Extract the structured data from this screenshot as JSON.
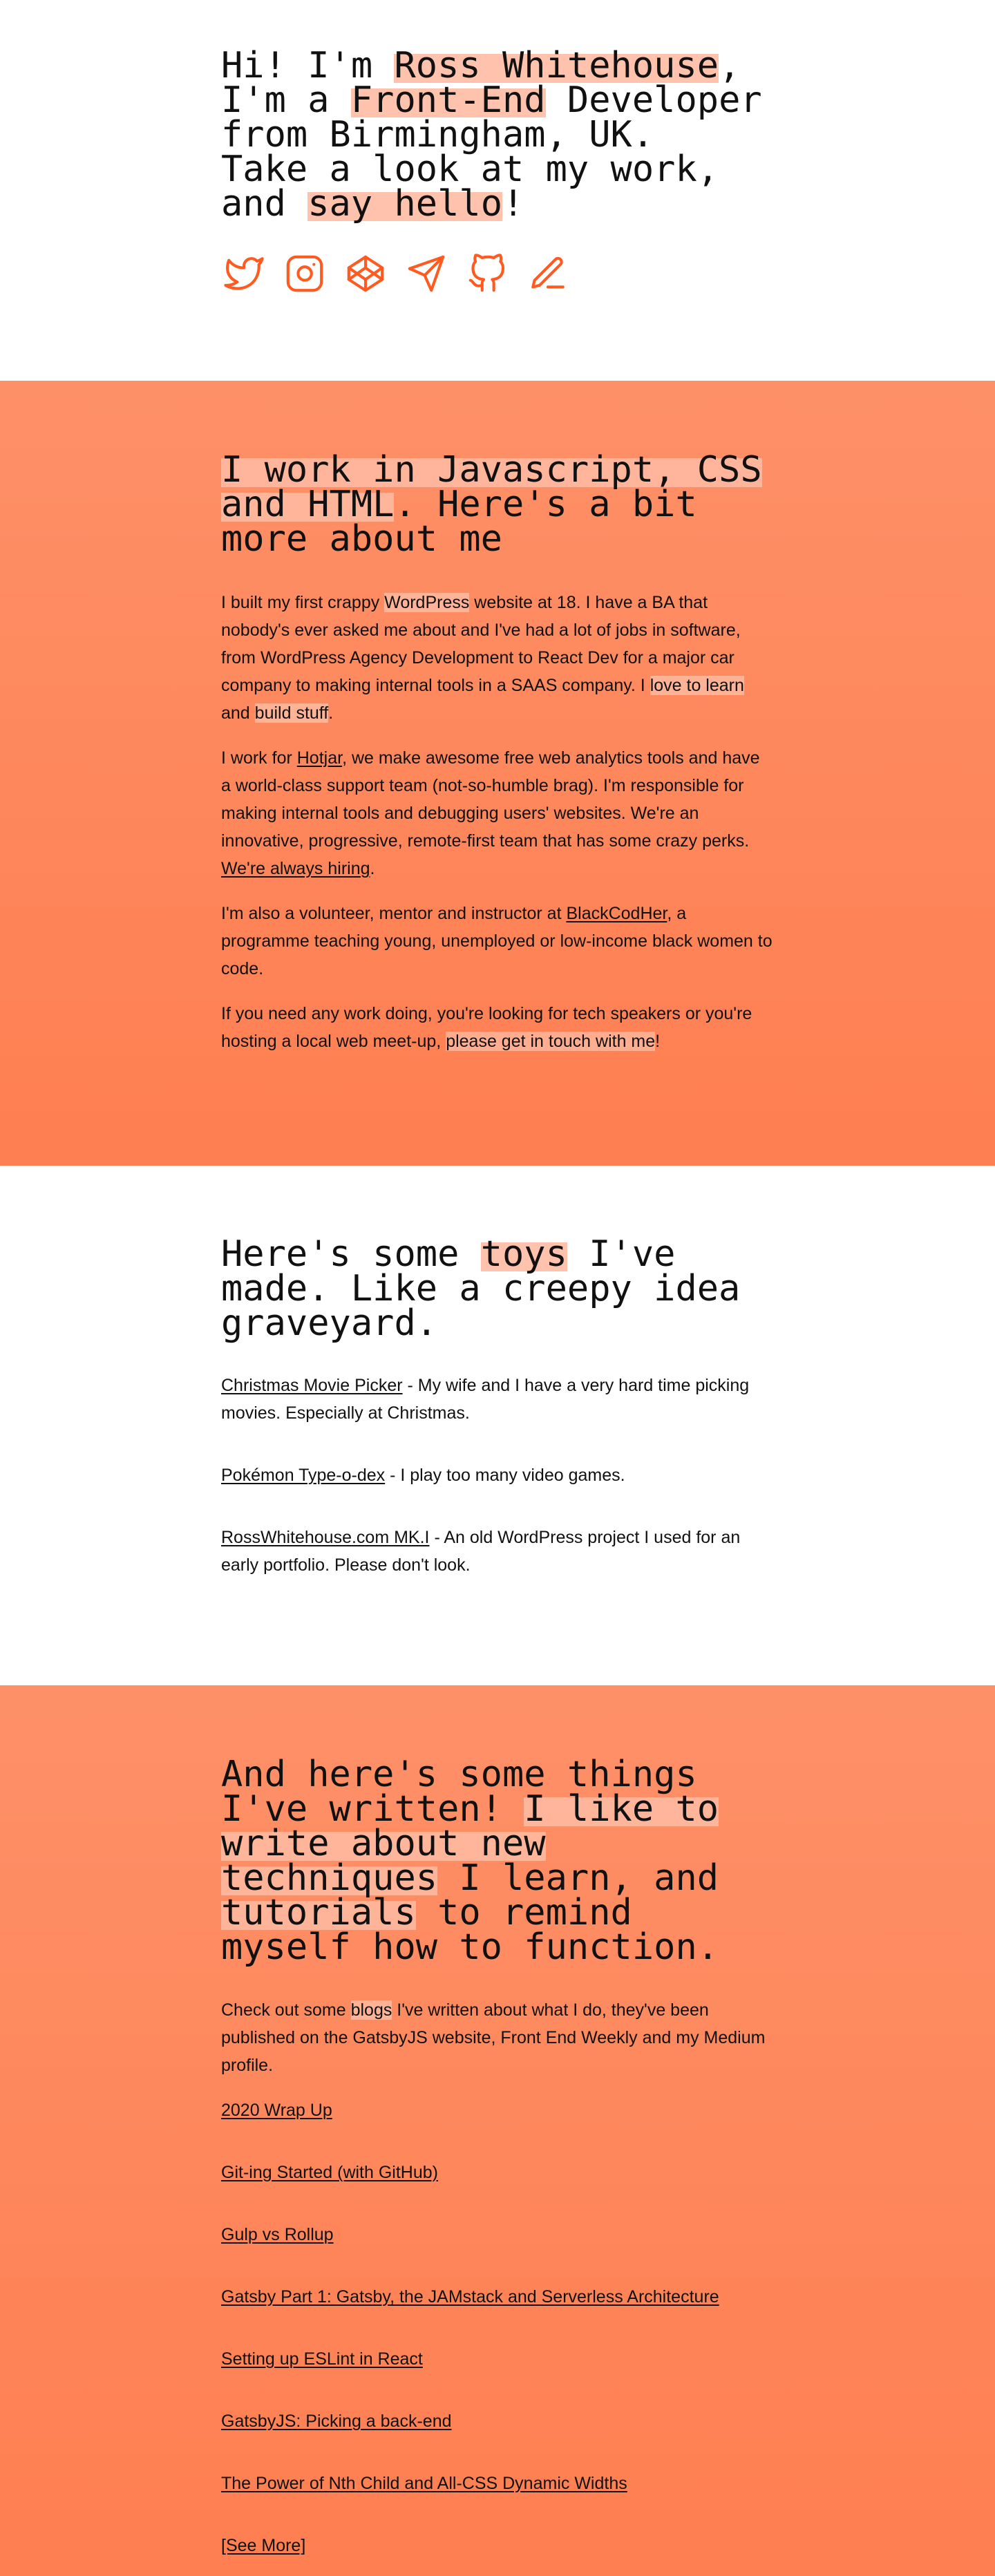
{
  "colors": {
    "accent": "#ff5a1f",
    "highlight": "#ffb79c",
    "section_gradient_top": "#fe9068",
    "section_gradient_bottom": "#fe7f51",
    "text": "#111111"
  },
  "hero": {
    "greeting_prefix": "Hi! I'm ",
    "name": "Ross Whitehouse",
    "comma": ",",
    "role_prefix": "I'm a ",
    "role": "Front-End",
    "role_suffix": " Developer",
    "location": "from Birmingham, UK.",
    "cta_line": "Take a look at my work,",
    "and": "and ",
    "say_hello": "say hello",
    "exclaim": "!",
    "social_icons": [
      "twitter-icon",
      "instagram-icon",
      "codepen-icon",
      "send-icon",
      "github-icon",
      "pen-icon"
    ]
  },
  "about": {
    "title_part1": "I work in Javascript, CSS",
    "title_part2": "and HTML",
    "title_part3": ". Here's a bit more about me",
    "p1_part1": "I built my first crappy ",
    "p1_wordpress": "WordPress",
    "p1_part2": " website at 18. I have a BA that nobody's ever asked me about and I've had a lot of jobs in software, from WordPress Agency Development to React Dev for a major car company to making internal tools in a SAAS company. I ",
    "p1_learn": "love to learn",
    "p1_and": " and ",
    "p1_build": "build stuff",
    "p1_end": ".",
    "p2_part1": "I work for ",
    "p2_hotjar": "Hotjar",
    "p2_part2": ", we make awesome free web analytics tools and have a world-class support team (not-so-humble brag). I'm responsible for making internal tools and debugging users' websites. We're an innovative, progressive, remote-first team that has some crazy perks. ",
    "p2_hiring": "We're always hiring",
    "p2_end": ".",
    "p3_part1": "I'm also a volunteer, mentor and instructor at ",
    "p3_bch": "BlackCodHer",
    "p3_part2": ", a programme teaching young, unemployed or low-income black women to code.",
    "p4_part1": "If you need any work doing, you're looking for tech speakers or you're hosting a local web meet-up, ",
    "p4_touch": "please get in touch with me",
    "p4_end": "!"
  },
  "toys": {
    "title_part1": "Here's some ",
    "title_toys": "toys",
    "title_part2": " I've made. Like a creepy idea graveyard.",
    "items": [
      {
        "label": "Christmas Movie Picker",
        "desc": " - My wife and I have a very hard time picking movies. Especially at Christmas."
      },
      {
        "label": "Pokémon Type-o-dex",
        "desc": " - I play too many video games."
      },
      {
        "label": "RossWhitehouse.com MK.I",
        "desc": " - An old WordPress project I used for an early portfolio. Please don't look."
      }
    ]
  },
  "writing": {
    "title_part1": "And here's some things I've written! ",
    "title_part2": "I like to write about new techniques",
    "title_part3": " I learn, and ",
    "title_part4": "tutorials",
    "title_part5": " to remind myself how to function.",
    "intro_part1": "Check out some ",
    "intro_blogs": "blogs",
    "intro_part2": " I've written about what I do, they've been published on the GatsbyJS website, Front End Weekly and my Medium profile.",
    "posts": [
      "2020 Wrap Up",
      "Git-ing Started (with GitHub)",
      "Gulp vs Rollup",
      "Gatsby Part 1: Gatsby, the JAMstack and Serverless Architecture",
      "Setting up ESLint in React",
      "GatsbyJS: Picking a back-end",
      "The Power of Nth Child and All-CSS Dynamic Widths"
    ],
    "see_more": "[See More]"
  }
}
